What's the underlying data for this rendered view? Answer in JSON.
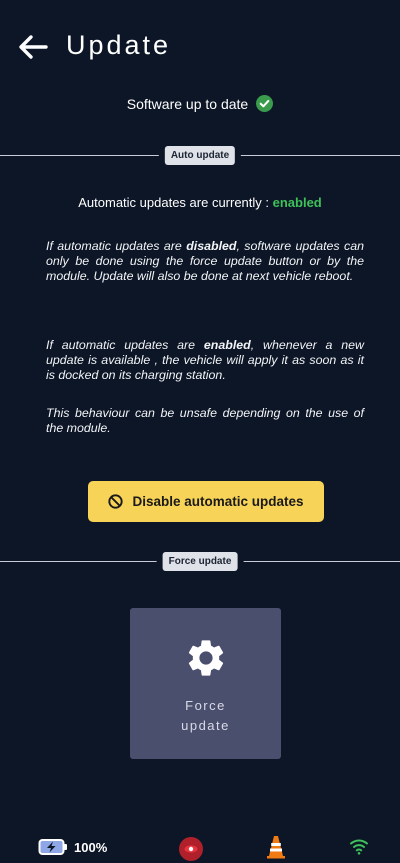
{
  "header": {
    "title": "Update",
    "back_icon": "arrow-left-icon"
  },
  "status": {
    "text": "Software up to date",
    "icon": "check-circle-icon",
    "icon_color": "#3a9b4c"
  },
  "auto_section": {
    "label": "Auto update",
    "status_prefix": "Automatic updates are currently : ",
    "status_value": "enabled",
    "status_color": "#3ec05a",
    "para1": {
      "pre": "If automatic updates are ",
      "bold": "disabled",
      "post": ", software updates can only be done using the force update button or by the module. Update will also be done at next vehicle reboot."
    },
    "para2": {
      "pre": "If automatic updates are ",
      "bold": "enabled",
      "post": ", whenever a new update is available , the vehicle will apply it as soon as it is docked on its charging station."
    },
    "para3": "This behaviour can be unsafe depending on the use of the module.",
    "disable_button": {
      "label": "Disable automatic updates",
      "icon": "ban-icon",
      "color": "#f7d357"
    }
  },
  "force_section": {
    "label": "Force update",
    "card": {
      "label": "Force update",
      "icon": "gear-icon",
      "color": "#4b4f6e"
    }
  },
  "bottom_bar": {
    "battery_percent": "100%",
    "battery_icon": "battery-charging-icon",
    "robot_icon": "robot-eye-icon",
    "robot_color": "#b0202a",
    "cone_icon": "traffic-cone-icon",
    "cone_color": "#f07a14",
    "wifi_icon": "wifi-icon",
    "wifi_color": "#3ec05a"
  }
}
